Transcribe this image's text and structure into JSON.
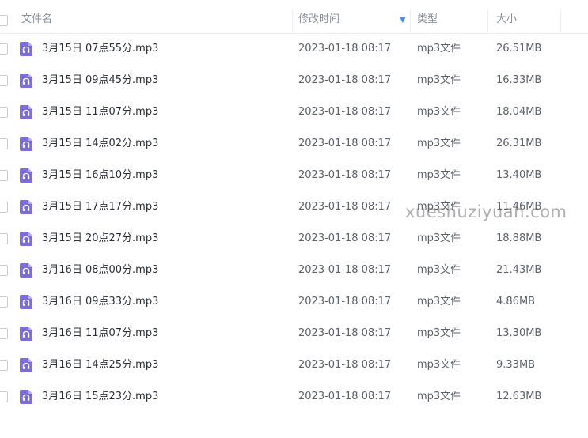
{
  "header": {
    "name_col": "文件名",
    "date_col": "修改时间",
    "type_col": "类型",
    "size_col": "大小",
    "sort_icon": "sort-down-arrow-icon"
  },
  "files": [
    {
      "name": "3月15日 07点55分.mp3",
      "date": "2023-01-18 08:17",
      "type": "mp3文件",
      "size": "26.51MB"
    },
    {
      "name": "3月15日 09点45分.mp3",
      "date": "2023-01-18 08:17",
      "type": "mp3文件",
      "size": "16.33MB"
    },
    {
      "name": "3月15日 11点07分.mp3",
      "date": "2023-01-18 08:17",
      "type": "mp3文件",
      "size": "18.04MB"
    },
    {
      "name": "3月15日 14点02分.mp3",
      "date": "2023-01-18 08:17",
      "type": "mp3文件",
      "size": "26.31MB"
    },
    {
      "name": "3月15日 16点10分.mp3",
      "date": "2023-01-18 08:17",
      "type": "mp3文件",
      "size": "13.40MB"
    },
    {
      "name": "3月15日 17点17分.mp3",
      "date": "2023-01-18 08:17",
      "type": "mp3文件",
      "size": "11.46MB"
    },
    {
      "name": "3月15日 20点27分.mp3",
      "date": "2023-01-18 08:17",
      "type": "mp3文件",
      "size": "18.88MB"
    },
    {
      "name": "3月16日 08点00分.mp3",
      "date": "2023-01-18 08:17",
      "type": "mp3文件",
      "size": "21.43MB"
    },
    {
      "name": "3月16日 09点33分.mp3",
      "date": "2023-01-18 08:17",
      "type": "mp3文件",
      "size": "4.86MB"
    },
    {
      "name": "3月16日 11点07分.mp3",
      "date": "2023-01-18 08:17",
      "type": "mp3文件",
      "size": "13.30MB"
    },
    {
      "name": "3月16日 14点25分.mp3",
      "date": "2023-01-18 08:17",
      "type": "mp3文件",
      "size": "9.33MB"
    },
    {
      "name": "3月16日 15点23分.mp3",
      "date": "2023-01-18 08:17",
      "type": "mp3文件",
      "size": "12.63MB"
    }
  ],
  "watermark": "xueshuziyuan.com",
  "colors": {
    "file_icon": "#7b6fd6",
    "sort_icon": "#4a90e2",
    "header_text": "#8a8f99",
    "divider": "#eceef2"
  },
  "file_icon_name": "music-file-icon"
}
